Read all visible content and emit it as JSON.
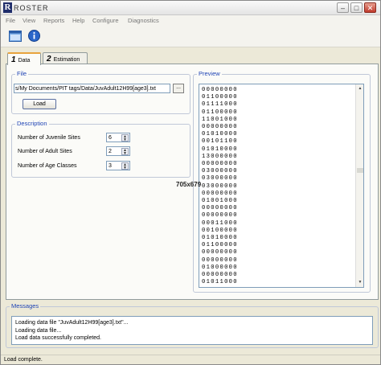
{
  "app": {
    "logo_letter": "R",
    "title": "ROSTER"
  },
  "window_controls": {
    "minimize": "–",
    "maximize": "□",
    "close": "✕"
  },
  "menu": [
    "File",
    "View",
    "Reports",
    "Help",
    "Configure",
    "Diagnostics"
  ],
  "toolbar": {
    "icons": [
      "window-layout-icon",
      "info-icon"
    ]
  },
  "tabs": [
    {
      "num": "1",
      "label": "Data",
      "active": true
    },
    {
      "num": "2",
      "label": "Estimation",
      "active": false
    }
  ],
  "file_group": {
    "title": "File",
    "path": "s/My Documents/PIT tags/Data/JuvAdult12H99[age3].txt",
    "browse_label": "...",
    "load_label": "Load"
  },
  "description": {
    "title": "Description",
    "fields": [
      {
        "label": "Number of Juvenile Sites",
        "value": "6"
      },
      {
        "label": "Number of Adult Sites",
        "value": "2"
      },
      {
        "label": "Number of Age Classes",
        "value": "3"
      }
    ]
  },
  "preview": {
    "title": "Preview",
    "rows": [
      "00000000",
      "01100000",
      "01111000",
      "01100000",
      "11001000",
      "00000000",
      "01010000",
      "00101100",
      "01010000",
      "13000000",
      "00000000",
      "03000000",
      "03000000",
      "03000000",
      "00000000",
      "01001000",
      "00000000",
      "00000000",
      "00011000",
      "00100000",
      "01010000",
      "01100000",
      "00000000",
      "00000000",
      "01000000",
      "00000000",
      "01011000"
    ]
  },
  "messages": {
    "title": "Messages",
    "lines": [
      "Loading data file \"JuvAdult12H99[age3].txt\"...",
      "Loading data file...",
      "Load data successfully completed."
    ]
  },
  "status": "Load complete.",
  "overlay_text": "705x679",
  "colors": {
    "group_title": "#1f44b5",
    "active_tab_accent": "#e8a33d"
  }
}
